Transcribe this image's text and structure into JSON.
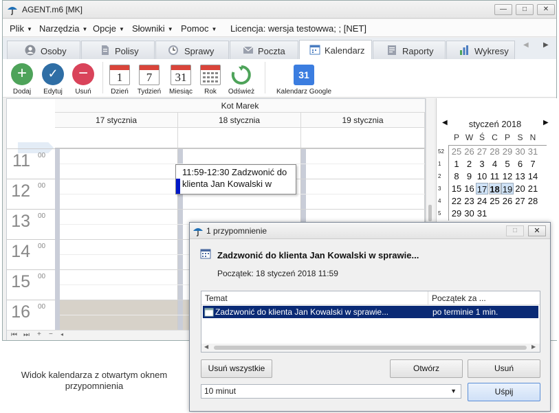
{
  "window": {
    "title": "AGENT.m6 [MK]",
    "minimize": "—",
    "maximize": "□",
    "close": "✕"
  },
  "menu": [
    {
      "label": "Plik"
    },
    {
      "label": "Narzędzia"
    },
    {
      "label": "Opcje"
    },
    {
      "label": "Słowniki"
    },
    {
      "label": "Pomoc"
    }
  ],
  "license": "Licencja: wersja testowwa; ;  [NET]",
  "tabs": [
    {
      "label": "Osoby",
      "icon": "person-icon"
    },
    {
      "label": "Polisy",
      "icon": "document-icon"
    },
    {
      "label": "Sprawy",
      "icon": "clock-icon"
    },
    {
      "label": "Poczta",
      "icon": "mail-icon"
    },
    {
      "label": "Kalendarz",
      "icon": "calendar-icon",
      "active": true
    },
    {
      "label": "Raporty",
      "icon": "report-icon"
    },
    {
      "label": "Wykresy",
      "icon": "chart-icon"
    }
  ],
  "toolbar": {
    "add": "Dodaj",
    "edit": "Edytuj",
    "remove": "Usuń",
    "day": "Dzień",
    "day_num": "1",
    "week": "Tydzień",
    "week_num": "7",
    "month": "Miesiąc",
    "month_num": "31",
    "year": "Rok",
    "refresh": "Odśwież",
    "google": "Kalendarz Google",
    "google_num": "31"
  },
  "calendar": {
    "owner": "Kot Marek",
    "days": [
      "17 stycznia",
      "18 stycznia",
      "19 stycznia"
    ],
    "hours": [
      "11",
      "12",
      "13",
      "14",
      "15",
      "16"
    ],
    "minutes": "00",
    "event": "11:59-12:30 Zadzwonić do klienta Jan Kowalski w"
  },
  "minical": {
    "title": "styczeń 2018",
    "dow": [
      "P",
      "W",
      "Ś",
      "C",
      "P",
      "S",
      "N"
    ],
    "weeks": [
      {
        "wk": "52",
        "days": [
          "25",
          "26",
          "27",
          "28",
          "29",
          "30",
          "31"
        ],
        "other": [
          0,
          1,
          2,
          3,
          4,
          5,
          6
        ]
      },
      {
        "wk": "1",
        "days": [
          "1",
          "2",
          "3",
          "4",
          "5",
          "6",
          "7"
        ],
        "other": []
      },
      {
        "wk": "2",
        "days": [
          "8",
          "9",
          "10",
          "11",
          "12",
          "13",
          "14"
        ],
        "other": []
      },
      {
        "wk": "3",
        "days": [
          "15",
          "16",
          "17",
          "18",
          "19",
          "20",
          "21"
        ],
        "other": []
      },
      {
        "wk": "4",
        "days": [
          "22",
          "23",
          "24",
          "25",
          "26",
          "27",
          "28"
        ],
        "other": []
      },
      {
        "wk": "5",
        "days": [
          "29",
          "30",
          "31",
          "",
          "",
          "",
          ""
        ],
        "other": []
      }
    ]
  },
  "dialog": {
    "title": "1 przypomnienie",
    "subject": "Zadzwonić do klienta Jan Kowalski w sprawie...",
    "start": "Początek: 18 styczeń 2018 11:59",
    "col_subject": "Temat",
    "col_start": "Początek za ...",
    "row_subject": "Zadzwonić do klienta Jan Kowalski w sprawie...",
    "row_start": "po terminie 1 min.",
    "btn_remove_all": "Usuń wszystkie",
    "btn_open": "Otwórz",
    "btn_remove": "Usuń",
    "snooze_value": "10 minut",
    "btn_snooze": "Uśpij"
  },
  "caption": "Widok kalendarza z otwartym oknem przypomnienia",
  "colors": {
    "accent": "#0a2a75",
    "add": "#4ea35a",
    "edit": "#2f6ea5",
    "remove": "#d9435a",
    "event_bar": "#0018c8"
  }
}
